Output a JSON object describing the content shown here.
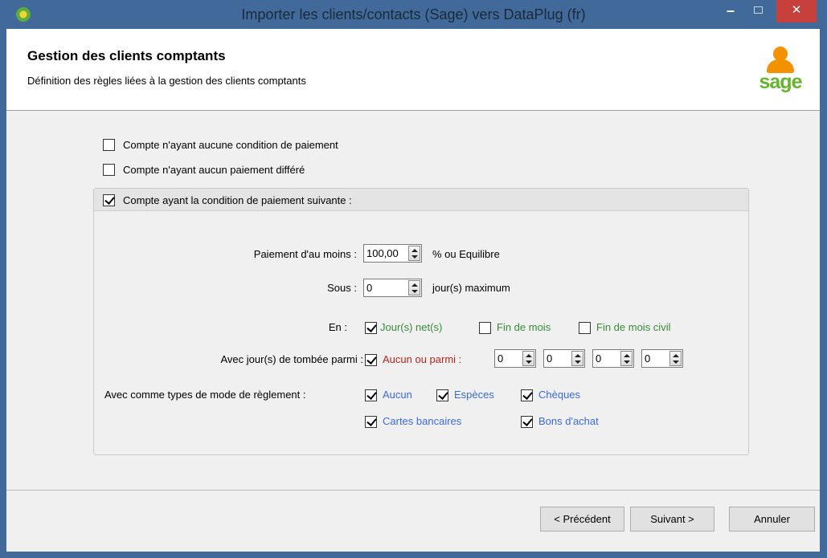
{
  "window": {
    "title": "Importer les clients/contacts (Sage) vers DataPlug (fr)",
    "minimize": "–",
    "close": "✕"
  },
  "header": {
    "title": "Gestion des clients comptants",
    "subtitle": "Définition des règles liées à la gestion des clients comptants",
    "logo_text": "sage"
  },
  "options": {
    "no_payment_condition": {
      "label": "Compte n'ayant aucune condition de paiement",
      "checked": false
    },
    "no_deferred_payment": {
      "label": "Compte n'ayant aucun paiement différé",
      "checked": false
    },
    "following_condition": {
      "label": "Compte ayant la condition de paiement suivante :",
      "checked": true
    }
  },
  "condition": {
    "payment_label": "Paiement d'au moins  :",
    "payment_value": "100,00",
    "payment_suffix": "% ou Equilibre",
    "within_label": "Sous :",
    "within_value": "0",
    "within_suffix": "jour(s) maximum",
    "in_label": "En :",
    "in_options": [
      {
        "label": "Jour(s) net(s)",
        "checked": true
      },
      {
        "label": "Fin de mois",
        "checked": false
      },
      {
        "label": "Fin de mois civil",
        "checked": false
      }
    ],
    "due_days_label": "Avec jour(s) de tombée parmi :",
    "due_days_option": {
      "label": "Aucun ou parmi :",
      "checked": true
    },
    "due_days_values": [
      "0",
      "0",
      "0",
      "0"
    ],
    "modes_label": "Avec comme types de mode de règlement :",
    "modes": [
      {
        "label": "Aucun",
        "checked": true
      },
      {
        "label": "Espèces",
        "checked": true
      },
      {
        "label": "Chèques",
        "checked": true
      },
      {
        "label": "Cartes bancaires",
        "checked": true
      },
      {
        "label": "Bons d'achat",
        "checked": true
      }
    ]
  },
  "buttons": {
    "previous": "< Précédent",
    "next": "Suivant >",
    "cancel": "Annuler"
  },
  "colors": {
    "titlebar": "#41699a",
    "close_button": "#c7413c",
    "green_label": "#3a8a3a",
    "red_label": "#b3261e",
    "blue_label": "#3c6bd4",
    "sage_orange": "#f39200",
    "sage_green": "#65b32e"
  }
}
